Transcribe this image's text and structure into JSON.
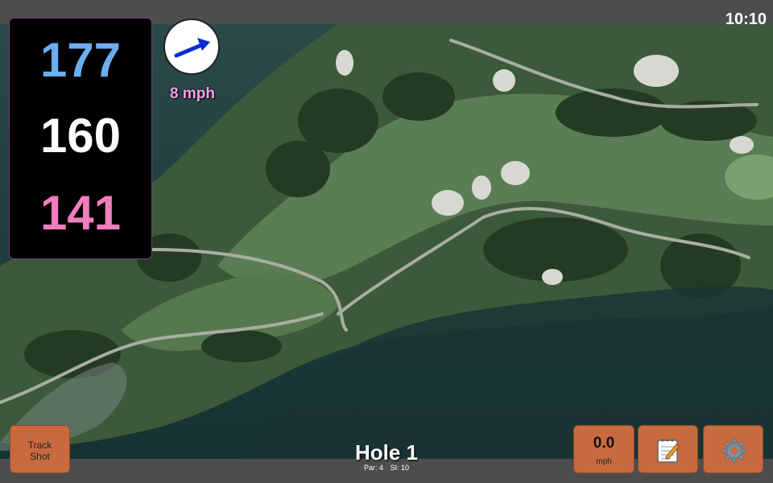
{
  "status_bar": {
    "time": "10:10"
  },
  "distances": {
    "back": "177",
    "middle": "160",
    "front": "141"
  },
  "wind": {
    "speed": "8 mph",
    "direction": "north-east",
    "arrow_color": "#0a2ad8"
  },
  "hole": {
    "title": "Hole 1",
    "par": "Par: 4",
    "stroke_index": "SI: 10"
  },
  "buttons": {
    "track_shot": "Track\nShot",
    "speed_value": "0.0",
    "speed_unit": "mph",
    "notes_icon": "notepad-icon",
    "settings_icon": "gear-icon"
  },
  "colors": {
    "back_distance": "#6aaef0",
    "middle_distance": "#ffffff",
    "front_distance": "#f07dbd",
    "button": "#c86a3e",
    "wind_text": "#ff9df0"
  }
}
